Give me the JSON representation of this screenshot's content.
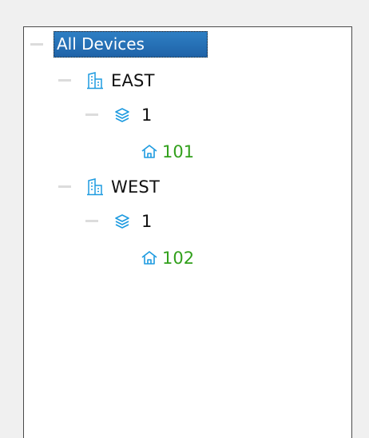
{
  "tree": {
    "root": {
      "label": "All Devices",
      "selected": true
    },
    "buildings": [
      {
        "label": "EAST",
        "icon": "building-icon",
        "floors": [
          {
            "label": "1",
            "icon": "layers-icon",
            "rooms": [
              {
                "label": "101",
                "icon": "home-icon"
              }
            ]
          }
        ]
      },
      {
        "label": "WEST",
        "icon": "building-icon",
        "floors": [
          {
            "label": "1",
            "icon": "layers-icon",
            "rooms": [
              {
                "label": "102",
                "icon": "home-icon"
              }
            ]
          }
        ]
      }
    ],
    "colors": {
      "selection": "#1f6db3",
      "icon_blue": "#1e9be0",
      "room_text": "#32a01c",
      "collapse_bar": "#dcdcdc"
    }
  }
}
